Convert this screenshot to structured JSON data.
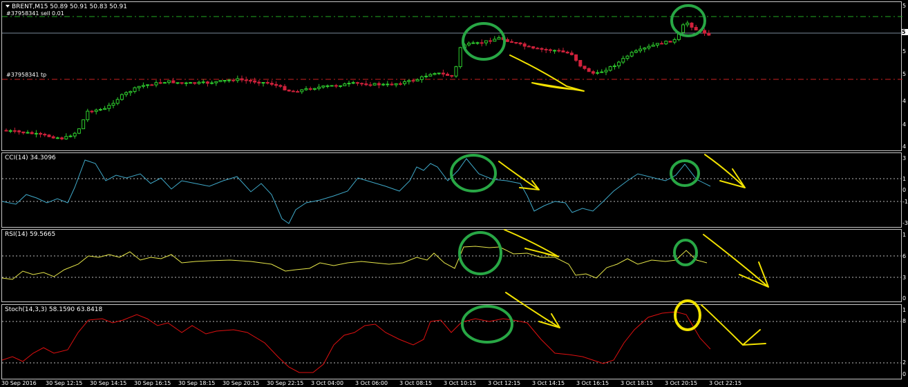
{
  "colors": {
    "bull": "#2fd12f",
    "bear": "#d0213b",
    "cci": "#3fa9c9",
    "rsi": "#e8e84a",
    "stoch": "#e01010",
    "green_level": "#22aa22",
    "red_level": "#cc2222",
    "annot_green": "#28a745",
    "annot_yellow": "#f2e200"
  },
  "main": {
    "title": "BRENT,M15  50.89 50.91 50.83 50.91",
    "sell_label": "#37958341 sell 0.01",
    "tp_label": "#37958341 tp",
    "price_box": "5",
    "scale": [
      "5",
      "5",
      "5",
      "4",
      "4",
      "4"
    ]
  },
  "cci": {
    "title": "CCI(14) 34.3096",
    "scale": [
      "3",
      "1",
      "0",
      "-1",
      "-3"
    ]
  },
  "rsi": {
    "title": "RSI(14) 59.5665",
    "scale": [
      "1",
      "6",
      "3",
      "0"
    ]
  },
  "stoch": {
    "title": "Stoch(14,3,3) 58.1590 63.8418",
    "scale": [
      "1",
      "8",
      "2",
      "0"
    ]
  },
  "xaxis": [
    "30 Sep 2016",
    "30 Sep 12:15",
    "30 Sep 14:15",
    "30 Sep 16:15",
    "30 Sep 18:15",
    "30 Sep 20:15",
    "30 Sep 22:15",
    "3 Oct 04:00",
    "3 Oct 06:00",
    "3 Oct 08:15",
    "3 Oct 10:15",
    "3 Oct 12:15",
    "3 Oct 14:15",
    "3 Oct 16:15",
    "3 Oct 18:15",
    "3 Oct 20:15",
    "3 Oct 22:15"
  ]
}
